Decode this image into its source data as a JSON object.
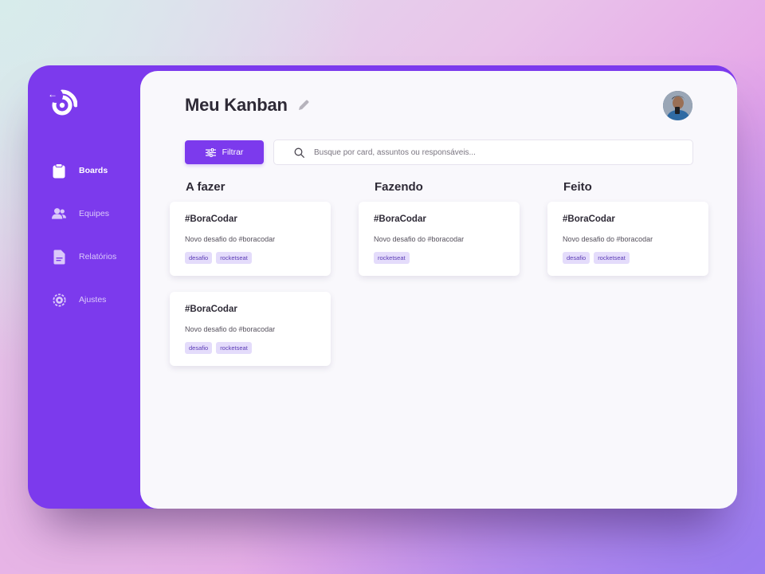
{
  "sidebar": {
    "back_glyph": "←",
    "items": [
      {
        "label": "Boards",
        "icon": "clipboard-icon",
        "active": true
      },
      {
        "label": "Equipes",
        "icon": "users-icon",
        "active": false
      },
      {
        "label": "Relatórios",
        "icon": "document-icon",
        "active": false
      },
      {
        "label": "Ajustes",
        "icon": "settings-icon",
        "active": false
      }
    ]
  },
  "header": {
    "title": "Meu Kanban"
  },
  "toolbar": {
    "filter_label": "Filtrar",
    "search_placeholder": "Busque por card, assuntos ou responsáveis..."
  },
  "columns": [
    {
      "title": "A fazer",
      "cards": [
        {
          "title": "#BoraCodar",
          "description": "Novo desafio do #boracodar",
          "tags": [
            "desafio",
            "rocketseat"
          ]
        },
        {
          "title": "#BoraCodar",
          "description": "Novo desafio do #boracodar",
          "tags": [
            "desafio",
            "rocketseat"
          ]
        }
      ]
    },
    {
      "title": "Fazendo",
      "cards": [
        {
          "title": "#BoraCodar",
          "description": "Novo desafio do #boracodar",
          "tags": [
            "rocketseat"
          ]
        }
      ]
    },
    {
      "title": "Feito",
      "cards": [
        {
          "title": "#BoraCodar",
          "description": "Novo desafio do #boracodar",
          "tags": [
            "desafio",
            "rocketseat"
          ]
        }
      ]
    }
  ],
  "colors": {
    "accent": "#7c3aed",
    "tag_bg": "#e4dcfb",
    "tag_text": "#5b3bb5"
  }
}
